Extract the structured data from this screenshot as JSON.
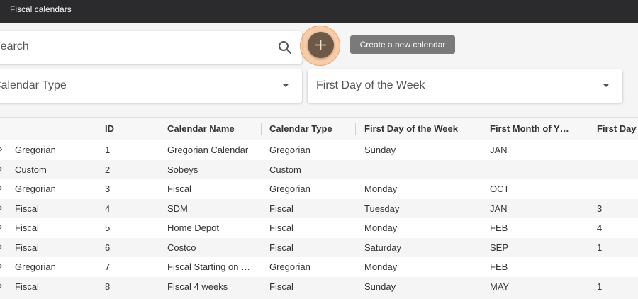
{
  "header": {
    "title": "Fiscal calendars"
  },
  "toolbar": {
    "search_placeholder": "Search",
    "create_label": "Create a new calendar",
    "calendar_type_label": "Calendar Type",
    "first_day_label": "First Day of the Week"
  },
  "colors": {
    "accent": "#6e5846",
    "highlight": "#f3a061",
    "topbar": "#2b2b2e"
  },
  "table": {
    "columns": [
      "",
      "ID",
      "Calendar Name",
      "Calendar Type",
      "First Day of the Week",
      "First Month of Y…",
      "First Day"
    ],
    "rows": [
      [
        "Gregorian",
        "1",
        "Gregorian Calendar",
        "Gregorian",
        "Sunday",
        "JAN",
        ""
      ],
      [
        "Custom",
        "2",
        "Sobeys",
        "Custom",
        "",
        "",
        ""
      ],
      [
        "Gregorian",
        "3",
        "Fiscal",
        "Gregorian",
        "Monday",
        "OCT",
        ""
      ],
      [
        "Fiscal",
        "4",
        "SDM",
        "Fiscal",
        "Tuesday",
        "JAN",
        "3"
      ],
      [
        "Fiscal",
        "5",
        "Home Depot",
        "Fiscal",
        "Monday",
        "FEB",
        "4"
      ],
      [
        "Fiscal",
        "6",
        "Costco",
        "Fiscal",
        "Saturday",
        "SEP",
        "1"
      ],
      [
        "Gregorian",
        "7",
        "Fiscal Starting on …",
        "Gregorian",
        "Monday",
        "FEB",
        ""
      ],
      [
        "Fiscal",
        "8",
        "Fiscal 4 weeks",
        "Fiscal",
        "Sunday",
        "MAY",
        "1"
      ]
    ]
  }
}
